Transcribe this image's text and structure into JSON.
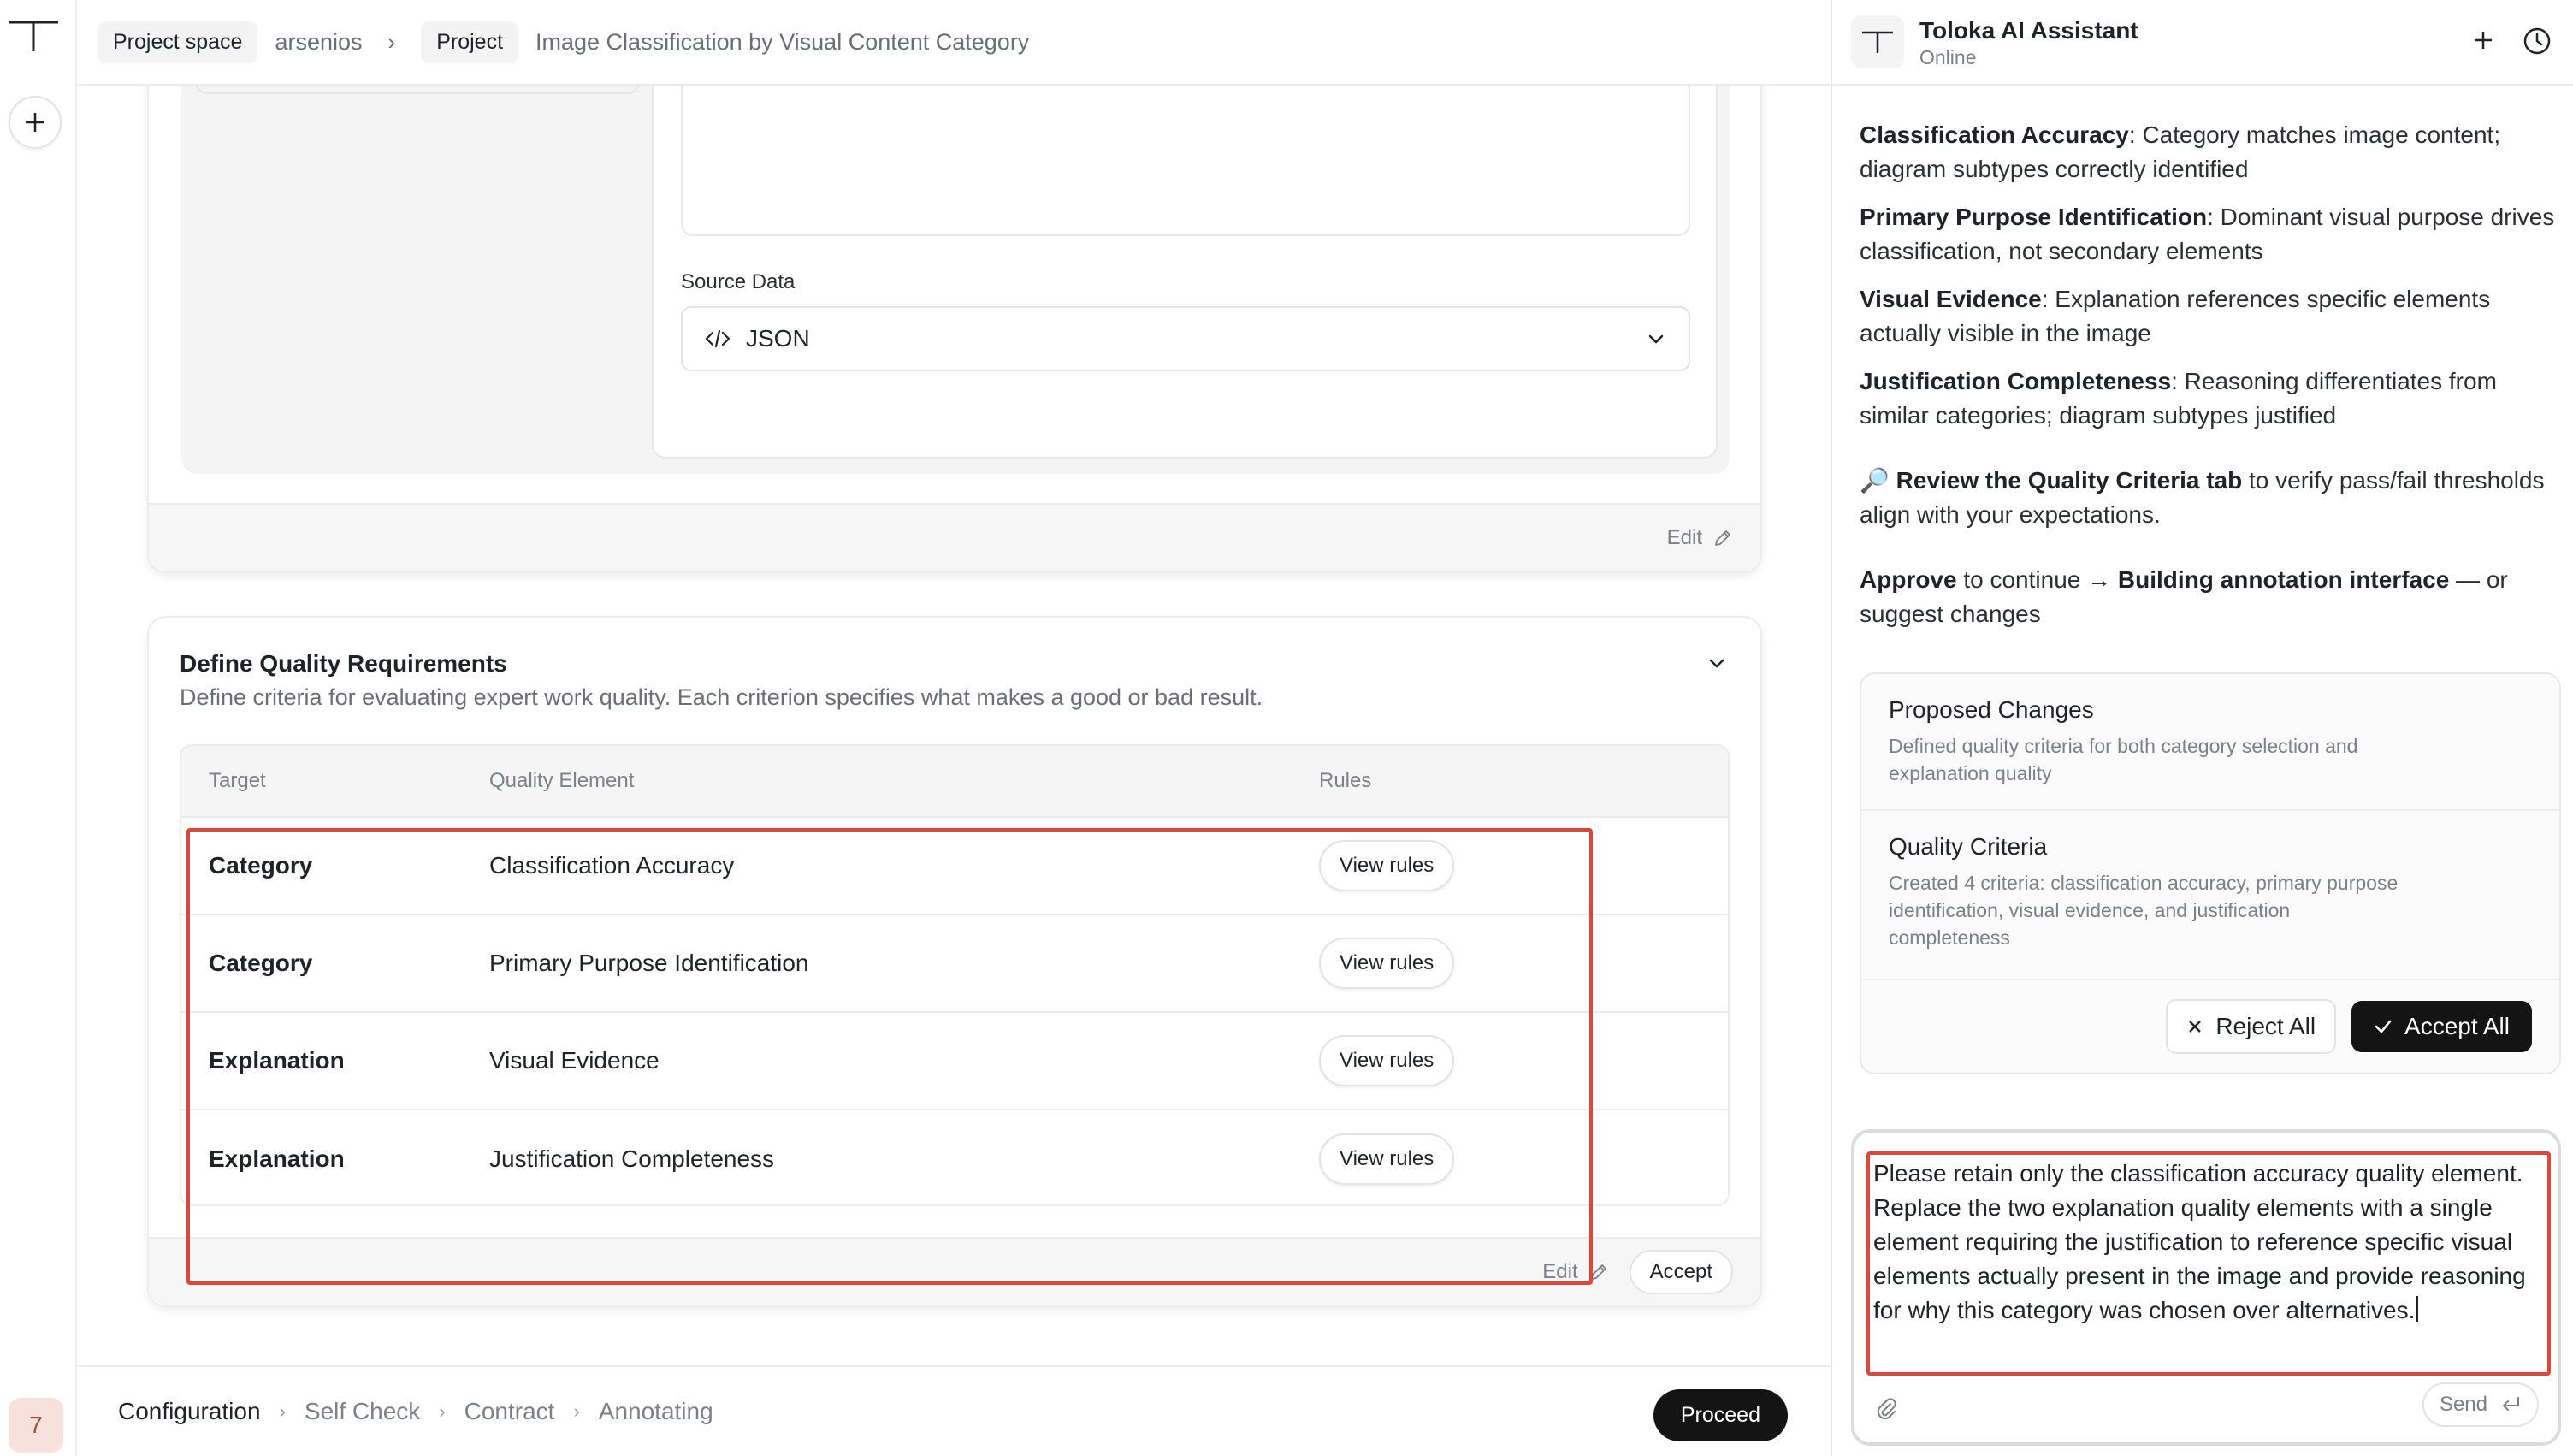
{
  "breadcrumb": {
    "project_space_label": "Project space",
    "space_name": "arsenios",
    "project_label": "Project",
    "project_name": "Image Classification by Visual Content Category"
  },
  "source_data": {
    "label": "Source Data",
    "selected": "JSON"
  },
  "card1_footer": {
    "edit_label": "Edit"
  },
  "quality": {
    "title": "Define Quality Requirements",
    "description": "Define criteria for evaluating expert work quality. Each criterion specifies what makes a good or bad result.",
    "columns": [
      "Target",
      "Quality Element",
      "Rules"
    ],
    "rows": [
      {
        "target": "Category",
        "element": "Classification Accuracy",
        "rules_button": "View rules"
      },
      {
        "target": "Category",
        "element": "Primary Purpose Identification",
        "rules_button": "View rules"
      },
      {
        "target": "Explanation",
        "element": "Visual Evidence",
        "rules_button": "View rules"
      },
      {
        "target": "Explanation",
        "element": "Justification Completeness",
        "rules_button": "View rules"
      }
    ],
    "edit_label": "Edit",
    "accept_label": "Accept"
  },
  "steps": {
    "items": [
      "Configuration",
      "Self Check",
      "Contract",
      "Annotating"
    ],
    "active": "Configuration",
    "proceed_label": "Proceed"
  },
  "rail": {
    "avatar_text": "7"
  },
  "chat": {
    "title": "Toloka AI Assistant",
    "status": "Online",
    "criteria": [
      {
        "name": "Classification Accuracy",
        "text": ": Category matches image content; diagram subtypes correctly identified"
      },
      {
        "name": "Primary Purpose Identification",
        "text": ": Dominant visual purpose drives classification, not secondary elements"
      },
      {
        "name": "Visual Evidence",
        "text": ": Explanation references specific elements actually visible in the image"
      },
      {
        "name": "Justification Completeness",
        "text": ": Reasoning differentiates from similar categories; diagram subtypes justified"
      }
    ],
    "review": {
      "emoji": "🔎",
      "bold": "Review the Quality Criteria tab",
      "rest": " to verify pass/fail thresholds align with your expectations."
    },
    "approve": {
      "bold1": "Approve",
      "mid": " to continue → ",
      "bold2": "Building annotation interface",
      "rest": " — or suggest changes"
    },
    "proposed": {
      "title": "Proposed Changes",
      "text": "Defined quality criteria for both category selection and explanation quality"
    },
    "criteria_card": {
      "title": "Quality Criteria",
      "text": "Created 4 criteria: classification accuracy, primary purpose identification, visual evidence, and justification completeness"
    },
    "reject_label": "Reject All",
    "accept_label": "Accept All",
    "composer_text": "Please retain only the classification accuracy quality element. Replace the two explanation quality elements with a single element requiring the justification to reference specific visual elements actually present in the image and provide reasoning for why this category was chosen over alternatives.",
    "send_label": "Send"
  },
  "colors": {
    "highlight": "#e0453a",
    "primary_button": "#141414",
    "muted_text": "#7c8087"
  }
}
